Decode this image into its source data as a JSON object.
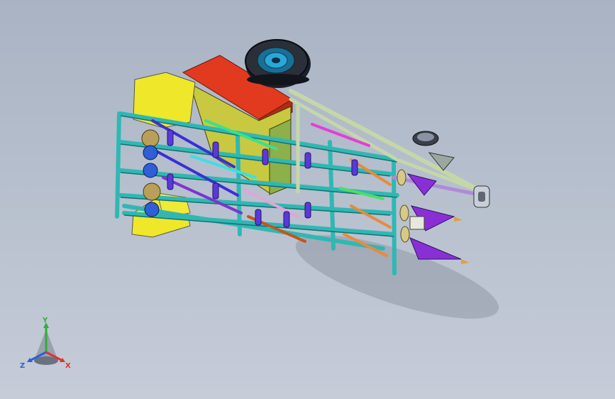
{
  "viewport": {
    "background_top": "#a9b3c3",
    "background_bottom": "#c6ccd8"
  },
  "triad": {
    "x_label": "X",
    "y_label": "Y",
    "z_label": "Z",
    "x_color": "#e0322e",
    "y_color": "#2fae3a",
    "z_color": "#2f5fd6"
  },
  "model": {
    "frame_color": "#2fb8b3",
    "hopper_color": "#e8e227",
    "top_panel_color": "#e23a1e",
    "wheel_color": "#1b1f2a",
    "hub_color": "#2aa7d8"
  }
}
